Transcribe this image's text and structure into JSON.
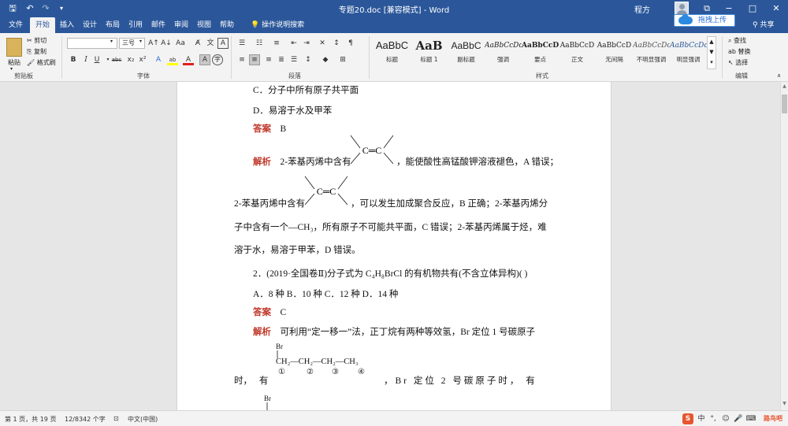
{
  "window": {
    "doc_title": "专题20.doc [兼容模式] - Word",
    "user_name": "程方",
    "controls": [
      "−",
      "□",
      "✕",
      "⧉"
    ]
  },
  "quick_access": {
    "save": "🖫",
    "undo": "↶",
    "redo": "↷"
  },
  "tabs": [
    {
      "label": "文件",
      "active": false
    },
    {
      "label": "开始",
      "active": true
    },
    {
      "label": "插入",
      "active": false
    },
    {
      "label": "设计",
      "active": false
    },
    {
      "label": "布局",
      "active": false
    },
    {
      "label": "引用",
      "active": false
    },
    {
      "label": "邮件",
      "active": false
    },
    {
      "label": "审阅",
      "active": false
    },
    {
      "label": "视图",
      "active": false
    },
    {
      "label": "帮助",
      "active": false
    }
  ],
  "help_search": "操作说明搜索",
  "share": "共享",
  "baidu_upload": "拖拽上传",
  "ribbon": {
    "clipboard": {
      "paste": "粘贴",
      "cut": "剪切",
      "copy": "复制",
      "format_painter": "格式刷",
      "group": "剪贴板"
    },
    "font": {
      "font_name": "",
      "font_size": "三号",
      "group": "字体",
      "glyphs": {
        "grow": "A↑",
        "shrink": "A↓",
        "case": "Aa",
        "clear": "A̸",
        "pinyin": "文",
        "border": "A"
      },
      "format_buttons": [
        "B",
        "I",
        "U",
        "abc",
        "x₂",
        "x²"
      ],
      "color_buttons": [
        "A",
        "ab",
        "A",
        "A",
        "字"
      ]
    },
    "paragraph": {
      "group": "段落"
    },
    "styles": {
      "group": "样式",
      "items": [
        {
          "sample": "AaBbC",
          "name": "标题"
        },
        {
          "sample": "AaB",
          "name": "标题 1"
        },
        {
          "sample": "AaBbC",
          "name": "副标题"
        },
        {
          "sample": "AaBbCcDc",
          "name": "强调"
        },
        {
          "sample": "AaBbCcD",
          "name": "要点"
        },
        {
          "sample": "AaBbCcD",
          "name": "正文"
        },
        {
          "sample": "AaBbCcD",
          "name": "无间隔"
        },
        {
          "sample": "AaBbCcDc",
          "name": "不明显强调"
        },
        {
          "sample": "AaBbCcDc",
          "name": "明显强调"
        }
      ]
    },
    "editing": {
      "find": "查找",
      "replace": "替换",
      "select": "选择",
      "group": "编辑"
    }
  },
  "document": {
    "l1": "C．分子中所有原子共平面",
    "l2": "D．易溶于水及甲苯",
    "ans1_label": "答案",
    "ans1": "B",
    "exp1_label": "解析",
    "exp1_a": "2-苯基丙烯中含有",
    "exp1_b": "，能使酸性高锰酸钾溶液褪色，A 错误；",
    "exp1_c": "2-苯基丙烯中含有",
    "exp1_d": "，可以发生加成聚合反应，B 正确；2-苯基丙烯分",
    "exp1_e": "子中含有一个—CH₃，所有原子不可能共平面，C 错误；2-苯基丙烯属于烃，难",
    "exp1_f": "溶于水，易溶于甲苯，D 错误。",
    "cc": "C═C",
    "q2": "2．(2019·全国卷Ⅱ)分子式为 C₄H₈BrCl 的有机物共有(不含立体异构)(        )",
    "q2_opts": "A．8 种   B．10 种   C．12 种   D．14 种",
    "ans2_label": "答案",
    "ans2": "C",
    "exp2_label": "解析",
    "exp2_a": "可利用“定一移一”法，正丁烷有两种等效氢，Br 定位 1 号碳原子",
    "br": "Br",
    "chain": "CH₂—CH₂—CH₂—CH₃",
    "nums": [
      "①",
      "②",
      "③",
      "④"
    ],
    "exp2_b_left": "时， 有",
    "exp2_b_right": "，Br 定位 2 号碳原子时， 有",
    "br2": "Br"
  },
  "status": {
    "page": "第 1 页，共 19 页",
    "words": "12/8342 个字",
    "lang": "中文(中国)"
  },
  "tray": {
    "ime": "中",
    "punct": "°,",
    "emoji": "☺",
    "mic": "🎤",
    "kb": "⌨",
    "brand": "路鸟吧"
  }
}
